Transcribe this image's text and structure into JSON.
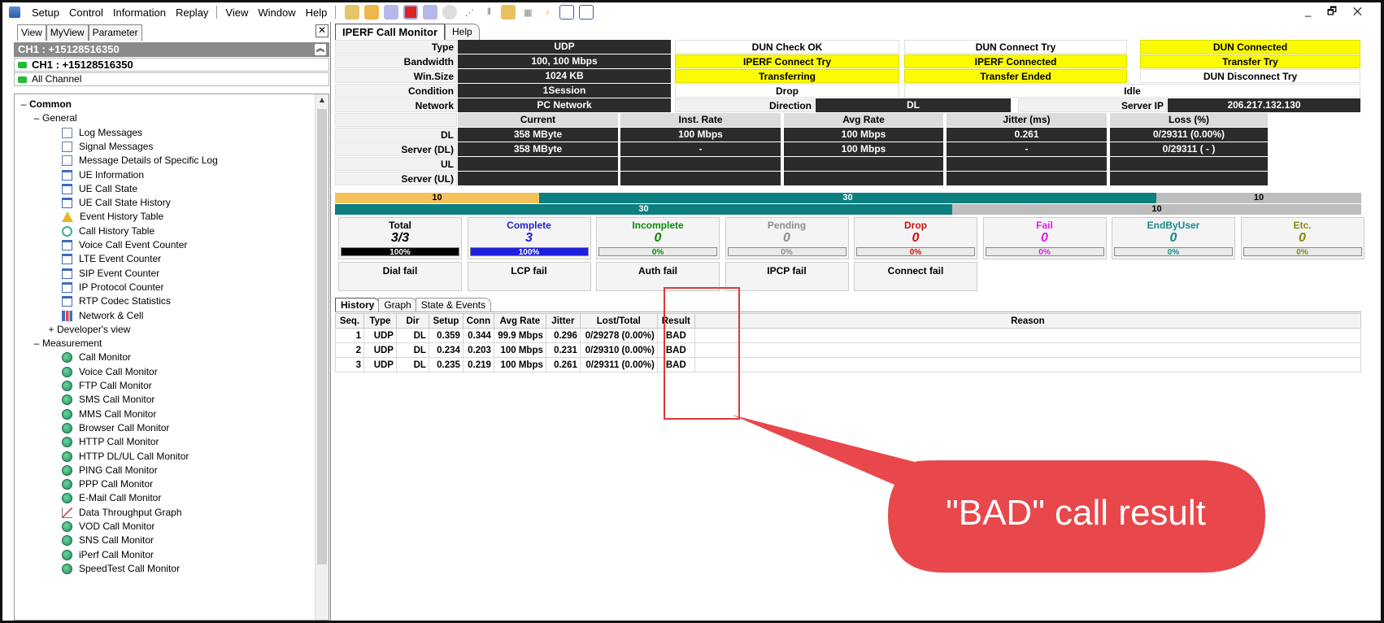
{
  "menu": [
    "Setup",
    "Control",
    "Information",
    "Replay",
    "View",
    "Window",
    "Help"
  ],
  "window_controls": "_ 🗗 ✕",
  "left": {
    "tabs": [
      "View",
      "MyView",
      "Parameter"
    ],
    "close": "✕",
    "channel_selected": "CH1 : +15128516350",
    "channel": "CH1 : +15128516350",
    "all_channel": "All Channel",
    "tree": {
      "common": "Common",
      "general": "General",
      "general_items": [
        "Log Messages",
        "Signal Messages",
        "Message Details of Specific Log",
        "UE Information",
        "UE Call State",
        "UE Call State History",
        "Event History Table",
        "Call History Table",
        "Voice Call Event Counter",
        "LTE Event Counter",
        "SIP Event Counter",
        "IP Protocol Counter",
        "RTP Codec Statistics",
        "Network & Cell"
      ],
      "developers_view": "Developer's view",
      "measurement": "Measurement",
      "measurement_items": [
        "Call Monitor",
        "Voice Call Monitor",
        "FTP Call Monitor",
        "SMS Call Monitor",
        "MMS Call Monitor",
        "Browser Call Monitor",
        "HTTP Call Monitor",
        "HTTP DL/UL Call Monitor",
        "PING Call Monitor",
        "PPP Call Monitor",
        "E-Mail Call Monitor",
        "Data Throughput Graph",
        "VOD Call Monitor",
        "SNS Call Monitor",
        "iPerf Call Monitor",
        "SpeedTest Call Monitor"
      ]
    }
  },
  "main": {
    "tabs": [
      "IPERF Call Monitor",
      "Help"
    ],
    "info": {
      "type_label": "Type",
      "type": "UDP",
      "bandwidth_label": "Bandwidth",
      "bandwidth": "100, 100 Mbps",
      "winsize_label": "Win.Size",
      "winsize": "1024 KB",
      "condition_label": "Condition",
      "condition": "1Session",
      "network_label": "Network",
      "network": "PC Network",
      "direction_label": "Direction",
      "direction": "DL",
      "server_ip_label": "Server IP",
      "server_ip": "206.217.132.130"
    },
    "states": {
      "dun_check_ok": "DUN Check OK",
      "dun_connect_try": "DUN Connect Try",
      "dun_connected": "DUN Connected",
      "iperf_connect_try": "IPERF Connect Try",
      "iperf_connected": "IPERF Connected",
      "transfer_try": "Transfer Try",
      "transferring": "Transferring",
      "transfer_ended": "Transfer Ended",
      "dun_disconnect_try": "DUN Disconnect Try",
      "drop": "Drop",
      "idle": "Idle"
    },
    "metrics": {
      "headers": [
        "Current",
        "Inst. Rate",
        "Avg Rate",
        "Jitter (ms)",
        "Loss (%)"
      ],
      "rows": [
        {
          "label": "DL",
          "values": [
            "358 MByte",
            "100 Mbps",
            "100 Mbps",
            "0.261",
            "0/29311 (0.00%)"
          ]
        },
        {
          "label": "Server (DL)",
          "values": [
            "358 MByte",
            "-",
            "100 Mbps",
            "-",
            "0/29311 ( - )"
          ]
        },
        {
          "label": "UL",
          "values": [
            "",
            "",
            "",
            "",
            ""
          ]
        },
        {
          "label": "Server (UL)",
          "values": [
            "",
            "",
            "",
            "",
            ""
          ]
        }
      ]
    },
    "bars": {
      "row1": [
        "10",
        "30",
        "10"
      ],
      "row2": [
        "30",
        "10"
      ]
    },
    "stats": [
      {
        "title": "Total",
        "value": "3/3",
        "pct": "100%",
        "color": "#000000"
      },
      {
        "title": "Complete",
        "value": "3",
        "pct": "100%",
        "color": "#1f1fd0"
      },
      {
        "title": "Incomplete",
        "value": "0",
        "pct": "0%",
        "color": "#0a8a0a"
      },
      {
        "title": "Pending",
        "value": "0",
        "pct": "0%",
        "color": "#8c8c8c"
      },
      {
        "title": "Drop",
        "value": "0",
        "pct": "0%",
        "color": "#d01010"
      },
      {
        "title": "Fail",
        "value": "0",
        "pct": "0%",
        "color": "#e020e0"
      },
      {
        "title": "EndByUser",
        "value": "0",
        "pct": "0%",
        "color": "#1a8a8a"
      },
      {
        "title": "Etc.",
        "value": "0",
        "pct": "0%",
        "color": "#8a8a10"
      }
    ],
    "fails": [
      "Dial fail",
      "LCP fail",
      "Auth fail",
      "IPCP fail",
      "Connect fail"
    ],
    "history_tabs": [
      "History",
      "Graph",
      "State & Events"
    ],
    "history": {
      "columns": [
        "Seq.",
        "Type",
        "Dir",
        "Setup",
        "Conn",
        "Avg Rate",
        "Jitter",
        "Lost/Total",
        "Result",
        "Reason"
      ],
      "rows": [
        [
          "1",
          "UDP",
          "DL",
          "0.359",
          "0.344",
          "99.9 Mbps",
          "0.296",
          "0/29278 (0.00%)",
          "BAD",
          ""
        ],
        [
          "2",
          "UDP",
          "DL",
          "0.234",
          "0.203",
          "100 Mbps",
          "0.231",
          "0/29310 (0.00%)",
          "BAD",
          ""
        ],
        [
          "3",
          "UDP",
          "DL",
          "0.235",
          "0.219",
          "100 Mbps",
          "0.261",
          "0/29311 (0.00%)",
          "BAD",
          ""
        ]
      ]
    }
  },
  "callout": {
    "text": "\"BAD\" call result",
    "color": "#e8474b"
  },
  "colors": {
    "yellow": "#fbfb00",
    "teal": "#0d7f7f",
    "orange": "#f4c25a",
    "gray": "#bdbdbd",
    "dark": "#2b2b2b"
  }
}
